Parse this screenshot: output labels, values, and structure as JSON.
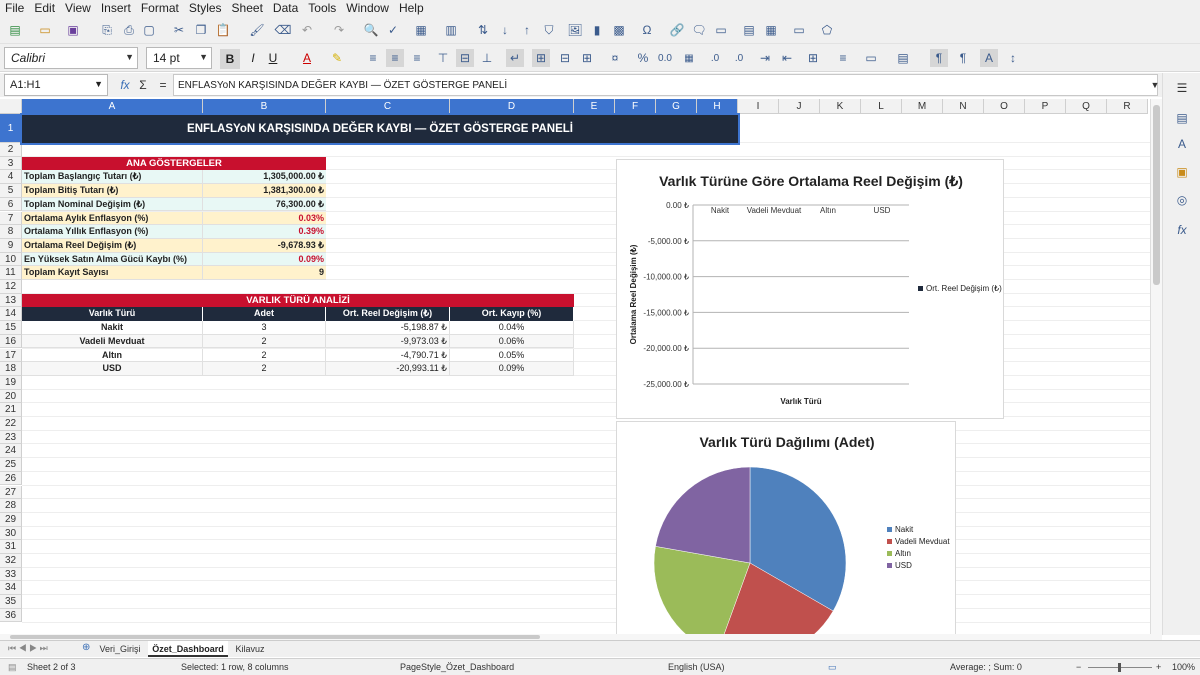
{
  "menu": [
    "File",
    "Edit",
    "View",
    "Insert",
    "Format",
    "Styles",
    "Sheet",
    "Data",
    "Tools",
    "Window",
    "Help"
  ],
  "toolbar": {
    "font_name": "Calibri",
    "font_size": "14 pt"
  },
  "formula_bar": {
    "cell_ref": "A1:H1",
    "content": "ENFLASYoN KARŞISINDA DEĞER KAYBI — ÖZET GÖSTERGE PANELİ"
  },
  "columns": [
    "A",
    "B",
    "C",
    "D",
    "E",
    "F",
    "G",
    "H",
    "I",
    "J",
    "K",
    "L",
    "M",
    "N",
    "O",
    "P",
    "Q",
    "R"
  ],
  "rows": [
    "1",
    "2",
    "3",
    "4",
    "5",
    "6",
    "7",
    "8",
    "9",
    "10",
    "11",
    "12",
    "13",
    "14",
    "15",
    "16",
    "17",
    "18",
    "19",
    "20",
    "21",
    "22",
    "23",
    "24",
    "25",
    "26",
    "27",
    "28",
    "29",
    "30",
    "31",
    "32",
    "33",
    "34",
    "35",
    "36"
  ],
  "sheet": {
    "title": "ENFLASYoN KARŞISINDA DEĞER KAYBI — ÖZET GÖSTERGE PANELİ",
    "kpi_header": "ANA GÖSTERGELER",
    "kpis": [
      {
        "label": "Toplam Başlangıç Tutarı (₺)",
        "value": "1,305,000.00 ₺",
        "red": false
      },
      {
        "label": "Toplam Bitiş Tutarı (₺)",
        "value": "1,381,300.00 ₺",
        "red": false
      },
      {
        "label": "Toplam Nominal Değişim (₺)",
        "value": "76,300.00 ₺",
        "red": false
      },
      {
        "label": "Ortalama Aylık Enflasyon (%)",
        "value": "0.03%",
        "red": true
      },
      {
        "label": "Ortalama Yıllık Enflasyon (%)",
        "value": "0.39%",
        "red": true
      },
      {
        "label": "Ortalama Reel Değişim (₺)",
        "value": "-9,678.93 ₺",
        "red": false
      },
      {
        "label": "En Yüksek Satın Alma Gücü Kaybı (%)",
        "value": "0.09%",
        "red": true
      },
      {
        "label": "Toplam Kayıt Sayısı",
        "value": "9",
        "red": false
      }
    ],
    "analysis_header": "VARLIK TÜRÜ ANALİZİ",
    "analysis_columns": [
      "Varlık Türü",
      "Adet",
      "Ort. Reel Değişim (₺)",
      "Ort. Kayıp (%)"
    ],
    "analysis_rows": [
      [
        "Nakit",
        "3",
        "-5,198.87 ₺",
        "0.04%"
      ],
      [
        "Vadeli Mevduat",
        "2",
        "-9,973.03 ₺",
        "0.06%"
      ],
      [
        "Altın",
        "2",
        "-4,790.71 ₺",
        "0.05%"
      ],
      [
        "USD",
        "2",
        "-20,993.11 ₺",
        "0.09%"
      ]
    ]
  },
  "chart_data": [
    {
      "type": "bar",
      "title": "Varlık Türüne Göre Ortalama Reel Değişim (₺)",
      "xlabel": "Varlık Türü",
      "ylabel": "Ortalama Reel Değişim (₺)",
      "categories": [
        "Nakit",
        "Vadeli Mevduat",
        "Altın",
        "USD"
      ],
      "series": [
        {
          "name": "Ort. Reel Değişim (₺)",
          "values": [
            0,
            0,
            0,
            0
          ]
        }
      ],
      "yticks": [
        "0.00 ₺",
        "-5,000.00 ₺",
        "-10,000.00 ₺",
        "-15,000.00 ₺",
        "-20,000.00 ₺",
        "-25,000.00 ₺"
      ],
      "ylim": [
        -25000,
        0
      ],
      "grid": true,
      "legend": "right"
    },
    {
      "type": "pie",
      "title": "Varlık Türü Dağılımı (Adet)",
      "categories": [
        "Nakit",
        "Vadeli Mevduat",
        "Altın",
        "USD"
      ],
      "values": [
        3,
        2,
        2,
        2
      ],
      "colors": [
        "#4f81bd",
        "#c0504d",
        "#9bbb59",
        "#8064a2"
      ],
      "legend": "right"
    }
  ],
  "tabs": [
    "Veri_Girişi",
    "Özet_Dashboard",
    "Kilavuz"
  ],
  "active_tab": "Özet_Dashboard",
  "status": {
    "sheet": "Sheet 2 of 3",
    "selection": "Selected: 1 row, 8 columns",
    "page_style": "PageStyle_Özet_Dashboard",
    "language": "English (USA)",
    "sum": "Average: ; Sum: 0",
    "zoom": "100%"
  },
  "colors": {
    "title_bg": "#1f2a3c",
    "section_red": "#c8102e",
    "kpi_light": "#fff2cc",
    "kpi_mint": "#e8f8f5",
    "selection": "#3d74cf"
  }
}
